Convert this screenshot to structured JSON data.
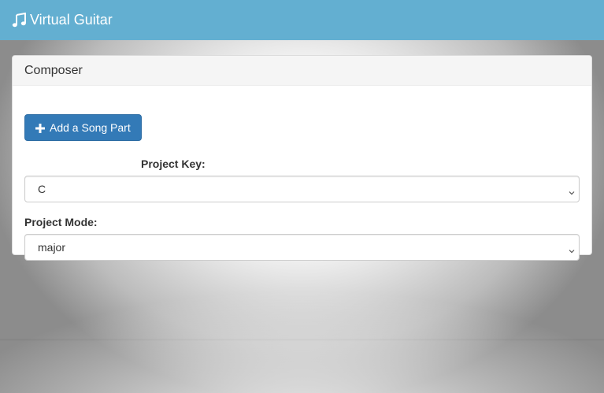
{
  "navbar": {
    "brand_icon": "music-note-icon",
    "brand_label": "Virtual Guitar",
    "color": "#63afd1"
  },
  "composer": {
    "title": "Composer",
    "add_button": {
      "icon": "plus-icon",
      "label": "Add a Song Part",
      "color": "#337ab7"
    },
    "project_key": {
      "label": "Project Key:",
      "value": "C"
    },
    "project_mode": {
      "label": "Project Mode:",
      "value": "major"
    }
  }
}
